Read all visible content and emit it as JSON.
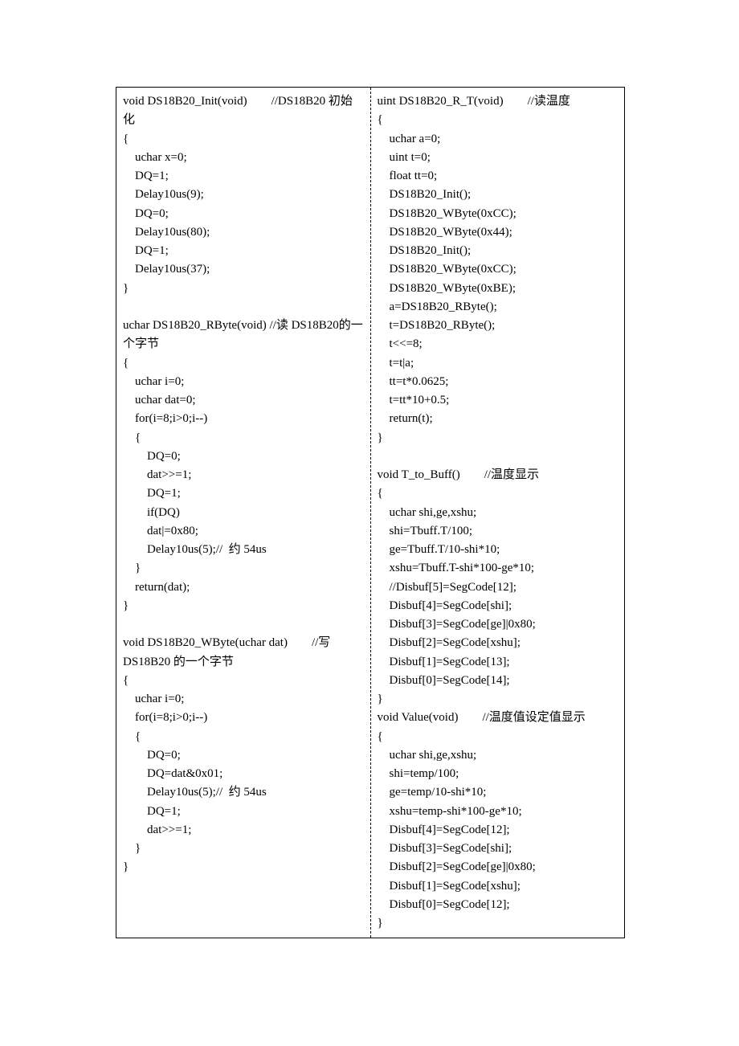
{
  "columns": {
    "left": {
      "code": "void DS18B20_Init(void)        //DS18B20 初始化\n{\n    uchar x=0;\n    DQ=1;\n    Delay10us(9);\n    DQ=0;\n    Delay10us(80);\n    DQ=1;\n    Delay10us(37);\n}\n\nuchar DS18B20_RByte(void) //读 DS18B20的一个字节\n{\n    uchar i=0;\n    uchar dat=0;\n    for(i=8;i>0;i--)\n    {\n        DQ=0;\n        dat>>=1;\n        DQ=1;\n        if(DQ)\n        dat|=0x80;\n        Delay10us(5);//  约 54us\n    }\n    return(dat);\n}\n\nvoid DS18B20_WByte(uchar dat)        //写 DS18B20 的一个字节\n{\n    uchar i=0;\n    for(i=8;i>0;i--)\n    {\n        DQ=0;\n        DQ=dat&0x01;\n        Delay10us(5);//  约 54us\n        DQ=1;\n        dat>>=1;\n    }\n}"
    },
    "right": {
      "code": "uint DS18B20_R_T(void)        //读温度\n{\n    uchar a=0;\n    uint t=0;\n    float tt=0;\n    DS18B20_Init();\n    DS18B20_WByte(0xCC);\n    DS18B20_WByte(0x44);\n    DS18B20_Init();\n    DS18B20_WByte(0xCC);\n    DS18B20_WByte(0xBE);\n    a=DS18B20_RByte();\n    t=DS18B20_RByte();\n    t<<=8;\n    t=t|a;\n    tt=t*0.0625;\n    t=tt*10+0.5;\n    return(t);\n}\n\nvoid T_to_Buff()        //温度显示\n{\n    uchar shi,ge,xshu;\n    shi=Tbuff.T/100;\n    ge=Tbuff.T/10-shi*10;\n    xshu=Tbuff.T-shi*100-ge*10;\n    //Disbuf[5]=SegCode[12];\n    Disbuf[4]=SegCode[shi];\n    Disbuf[3]=SegCode[ge]|0x80;\n    Disbuf[2]=SegCode[xshu];\n    Disbuf[1]=SegCode[13];\n    Disbuf[0]=SegCode[14];\n}\nvoid Value(void)        //温度值设定值显示\n{\n    uchar shi,ge,xshu;\n    shi=temp/100;\n    ge=temp/10-shi*10;\n    xshu=temp-shi*100-ge*10;\n    Disbuf[4]=SegCode[12];\n    Disbuf[3]=SegCode[shi];\n    Disbuf[2]=SegCode[ge]|0x80;\n    Disbuf[1]=SegCode[xshu];\n    Disbuf[0]=SegCode[12];\n}"
    }
  }
}
